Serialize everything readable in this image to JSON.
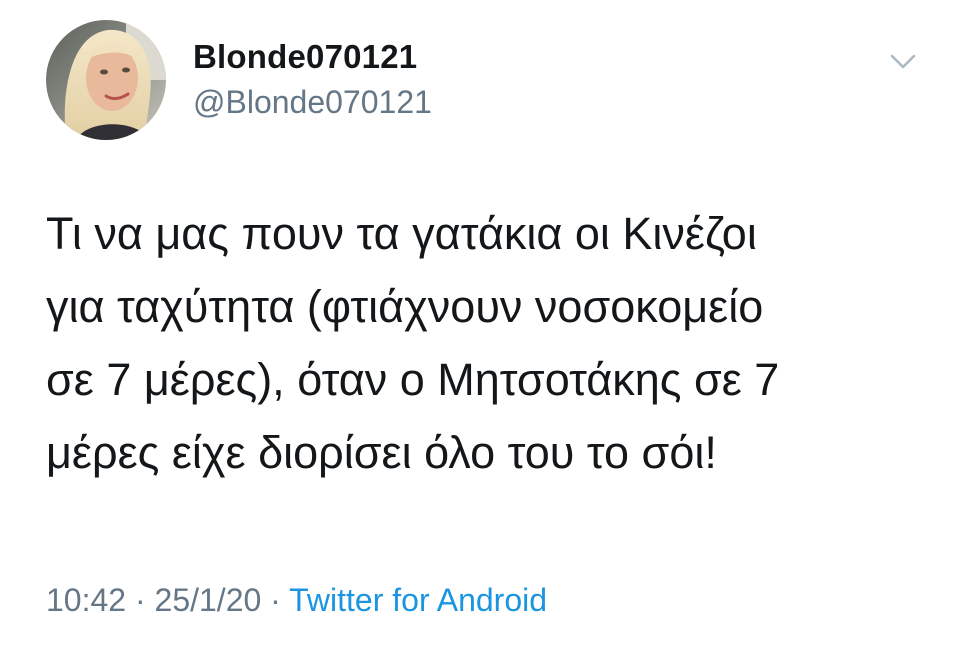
{
  "tweet": {
    "avatar_icon": "profile-photo",
    "display_name": "Blonde070121",
    "handle": "@Blonde070121",
    "menu_icon": "chevron-down-icon",
    "text_lines": [
      "Τι να μας πουν τα γατάκια οι Κινέζοι",
      "για ταχύτητα (φτιάχνουν νοσοκομείο",
      "σε 7 μέρες), όταν ο Μητσοτάκης σε 7",
      "μέρες είχε διορίσει όλο του το σόι!"
    ],
    "time": "10:42",
    "separator": "·",
    "date": "25/1/20",
    "source": "Twitter for Android"
  },
  "colors": {
    "text": "#14171a",
    "secondary": "#657786",
    "link": "#1b95e0",
    "chevron": "#aab8c2",
    "background": "#ffffff"
  }
}
